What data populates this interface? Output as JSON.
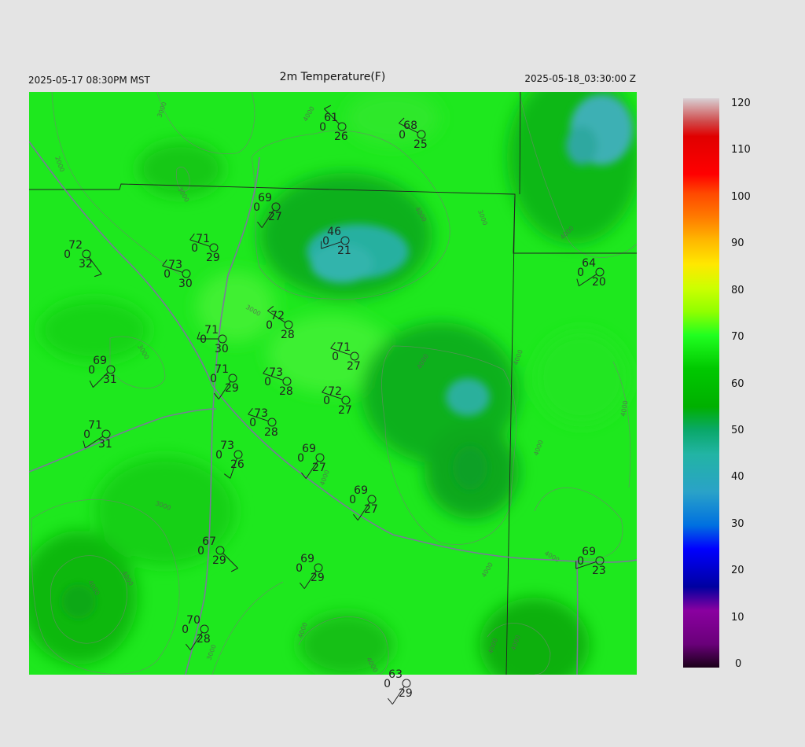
{
  "header": {
    "title": "2m Temperature(F)",
    "local_time": "2025-05-17 08:30PM MST",
    "utc_time": "2025-05-18_03:30:00 Z"
  },
  "colorbar": {
    "labels": [
      "120",
      "110",
      "100",
      "90",
      "80",
      "70",
      "60",
      "50",
      "40",
      "30",
      "20",
      "10",
      "0"
    ],
    "stops": [
      {
        "v": 0,
        "c": "#1a0018"
      },
      {
        "v": 5,
        "c": "#6a007a"
      },
      {
        "v": 12,
        "c": "#8a00a0"
      },
      {
        "v": 17,
        "c": "#0000a0"
      },
      {
        "v": 25,
        "c": "#0000ff"
      },
      {
        "v": 30,
        "c": "#0070e0"
      },
      {
        "v": 37,
        "c": "#2aa2c8"
      },
      {
        "v": 45,
        "c": "#22b4a4"
      },
      {
        "v": 50,
        "c": "#0aa86a"
      },
      {
        "v": 55,
        "c": "#00b000"
      },
      {
        "v": 63,
        "c": "#00c800"
      },
      {
        "v": 70,
        "c": "#20ff20"
      },
      {
        "v": 75,
        "c": "#90ff00"
      },
      {
        "v": 80,
        "c": "#ccff00"
      },
      {
        "v": 85,
        "c": "#ffe800"
      },
      {
        "v": 90,
        "c": "#ffb800"
      },
      {
        "v": 95,
        "c": "#ff7a00"
      },
      {
        "v": 100,
        "c": "#ff4800"
      },
      {
        "v": 104,
        "c": "#ff0000"
      },
      {
        "v": 112,
        "c": "#e00000"
      },
      {
        "v": 115,
        "c": "#d04848"
      },
      {
        "v": 120,
        "c": "#d8d0d4"
      }
    ]
  },
  "contour_labels": [
    "2000",
    "3000",
    "4000"
  ],
  "stations": [
    {
      "temp": "61",
      "dew": "26",
      "cloud": "0"
    },
    {
      "temp": "68",
      "dew": "25",
      "cloud": "0"
    },
    {
      "temp": "69",
      "dew": "27",
      "cloud": "0"
    },
    {
      "temp": "72",
      "dew": "32",
      "cloud": "0"
    },
    {
      "temp": "71",
      "dew": "29",
      "cloud": "0"
    },
    {
      "temp": "46",
      "dew": "21",
      "cloud": "0"
    },
    {
      "temp": "73",
      "dew": "30",
      "cloud": "0"
    },
    {
      "temp": "64",
      "dew": "20",
      "cloud": "0"
    },
    {
      "temp": "72",
      "dew": "28",
      "cloud": "0"
    },
    {
      "temp": "71",
      "dew": "30",
      "cloud": "0"
    },
    {
      "temp": "71",
      "dew": "27",
      "cloud": "0"
    },
    {
      "temp": "69",
      "dew": "31",
      "cloud": "0"
    },
    {
      "temp": "71",
      "dew": "29",
      "cloud": "0"
    },
    {
      "temp": "73",
      "dew": "28",
      "cloud": "0"
    },
    {
      "temp": "72",
      "dew": "27",
      "cloud": "0"
    },
    {
      "temp": "73",
      "dew": "28",
      "cloud": "0"
    },
    {
      "temp": "71",
      "dew": "31",
      "cloud": "0"
    },
    {
      "temp": "73",
      "dew": "26",
      "cloud": "0"
    },
    {
      "temp": "69",
      "dew": "27",
      "cloud": "0"
    },
    {
      "temp": "69",
      "dew": "27",
      "cloud": "0"
    },
    {
      "temp": "67",
      "dew": "29",
      "cloud": "0"
    },
    {
      "temp": "69",
      "dew": "29",
      "cloud": "0"
    },
    {
      "temp": "69",
      "dew": "23",
      "cloud": "0"
    },
    {
      "temp": "70",
      "dew": "28",
      "cloud": "0"
    },
    {
      "temp": "63",
      "dew": "29",
      "cloud": "0"
    }
  ]
}
